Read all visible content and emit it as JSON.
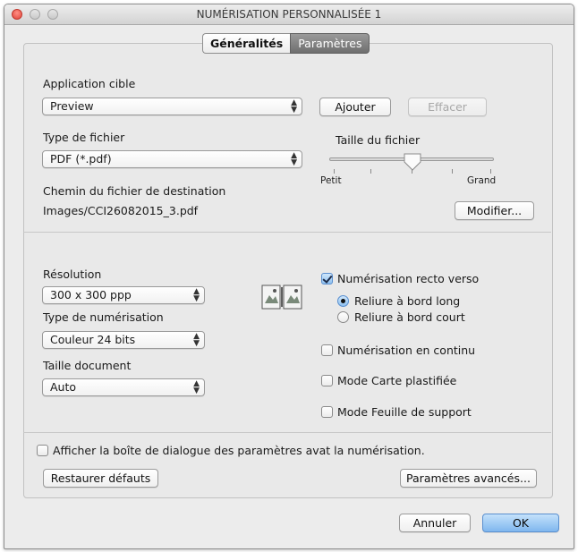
{
  "window": {
    "title": "NUMÉRISATION PERSONNALISÉE 1"
  },
  "tabs": [
    {
      "label": "Généralités",
      "active": false
    },
    {
      "label": "Paramètres",
      "active": true
    }
  ],
  "target_app": {
    "label": "Application cible",
    "value": "Preview",
    "add_label": "Ajouter",
    "clear_label": "Effacer"
  },
  "file_type": {
    "label": "Type de fichier",
    "value": "PDF (*.pdf)"
  },
  "file_size": {
    "label": "Taille du fichier",
    "min_label": "Petit",
    "max_label": "Grand",
    "level": 0.5
  },
  "destination": {
    "label": "Chemin du fichier de destination",
    "path": "Images/CCI26082015_3.pdf",
    "modify_label": "Modifier..."
  },
  "resolution": {
    "label": "Résolution",
    "value": "300 x 300 ppp"
  },
  "scan_type": {
    "label": "Type de numérisation",
    "value": "Couleur 24 bits"
  },
  "document_size": {
    "label": "Taille document",
    "value": "Auto"
  },
  "duplex": {
    "label": "Numérisation recto verso",
    "checked": true,
    "options": [
      {
        "label": "Reliure à bord long",
        "selected": true
      },
      {
        "label": "Reliure à bord court",
        "selected": false
      }
    ]
  },
  "continuous_scan": {
    "label": "Numérisation en continu",
    "checked": false
  },
  "plastic_card": {
    "label": "Mode Carte plastifiée",
    "checked": false
  },
  "carrier_sheet": {
    "label": "Mode Feuille de support",
    "checked": false
  },
  "show_dialog": {
    "label": "Afficher la boîte de dialogue des paramètres avat la numérisation.",
    "checked": false
  },
  "buttons": {
    "restore_defaults": "Restaurer défauts",
    "advanced_settings": "Paramètres avancés...",
    "cancel": "Annuler",
    "ok": "OK"
  },
  "colors": {
    "accent": "#7fb7ee",
    "window_bg": "#ececec",
    "close": "#e0443a"
  }
}
